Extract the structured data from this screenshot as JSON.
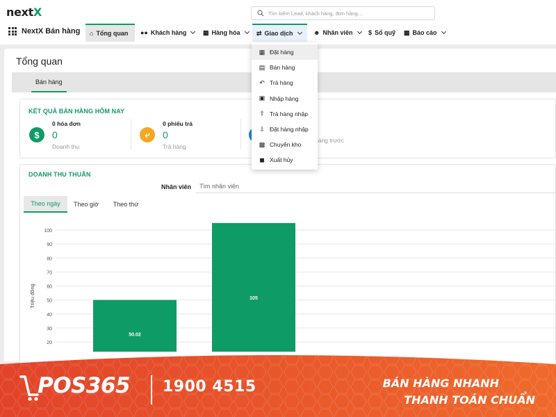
{
  "header": {
    "logo_main": "next",
    "logo_accent": "X",
    "search_placeholder": "Tìm kiếm Lead, khách hàng, đơn hàng...."
  },
  "nav": {
    "brand": "NextX Bán hàng",
    "items": [
      {
        "label": "Tổng quan",
        "icon": "home-icon"
      },
      {
        "label": "Khách hàng",
        "icon": "users-icon"
      },
      {
        "label": "Hàng hóa",
        "icon": "boxes-icon"
      },
      {
        "label": "Giao dịch",
        "icon": "exchange-icon"
      },
      {
        "label": "Nhân viên",
        "icon": "user-icon"
      },
      {
        "label": "Sổ quỹ",
        "icon": "dollar-icon"
      },
      {
        "label": "Báo cáo",
        "icon": "bar-chart-icon"
      }
    ]
  },
  "dropdown": {
    "items": [
      {
        "label": "Đặt hàng",
        "icon": "calendar-icon"
      },
      {
        "label": "Bán hàng",
        "icon": "document-icon"
      },
      {
        "label": "Trả hàng",
        "icon": "reply-icon"
      },
      {
        "label": "Nhập hàng",
        "icon": "cart-icon"
      },
      {
        "label": "Trả hàng nhập",
        "icon": "upload-icon"
      },
      {
        "label": "Đặt hàng nhập",
        "icon": "download-icon"
      },
      {
        "label": "Chuyển kho",
        "icon": "pallet-icon"
      },
      {
        "label": "Xuất hủy",
        "icon": "cubes-icon"
      }
    ]
  },
  "page": {
    "title": "Tổng quan",
    "tab": "Bán hàng"
  },
  "today": {
    "title": "KẾT QUẢ BÁN HÀNG HÔM NAY",
    "stats": [
      {
        "label": "0 hóa đơn",
        "value": "0",
        "sub": "Doanh thu",
        "color": "#0f9b65"
      },
      {
        "label": "0 phiếu trả",
        "value": "0",
        "sub": "Trả hàng",
        "color": "#f5a623"
      }
    ],
    "partial_sub": "háng trước"
  },
  "revenue": {
    "title": "DOANH THU THUẦN",
    "employee_label": "Nhân viên",
    "employee_placeholder": "Tìm nhân viên",
    "subtabs": [
      "Theo ngày",
      "Theo giờ",
      "Theo thứ"
    ]
  },
  "chart_data": {
    "type": "bar",
    "ylabel": "Triệu đồng",
    "yticks": [
      20,
      30,
      40,
      50,
      60,
      70,
      80,
      90,
      100
    ],
    "ylim": [
      20,
      105
    ],
    "grid": true,
    "bar_color": "#0f9b65",
    "series": [
      {
        "values": [
          50.02,
          105
        ]
      }
    ],
    "value_labels": [
      "50.02",
      "105"
    ]
  },
  "banner": {
    "brand": "POS365",
    "phone": "1900 4515",
    "slogan_line1": "BÁN HÀNG NHANH",
    "slogan_line2": "THANH TOÁN CHUẨN",
    "bg_color": "#e8512a"
  }
}
